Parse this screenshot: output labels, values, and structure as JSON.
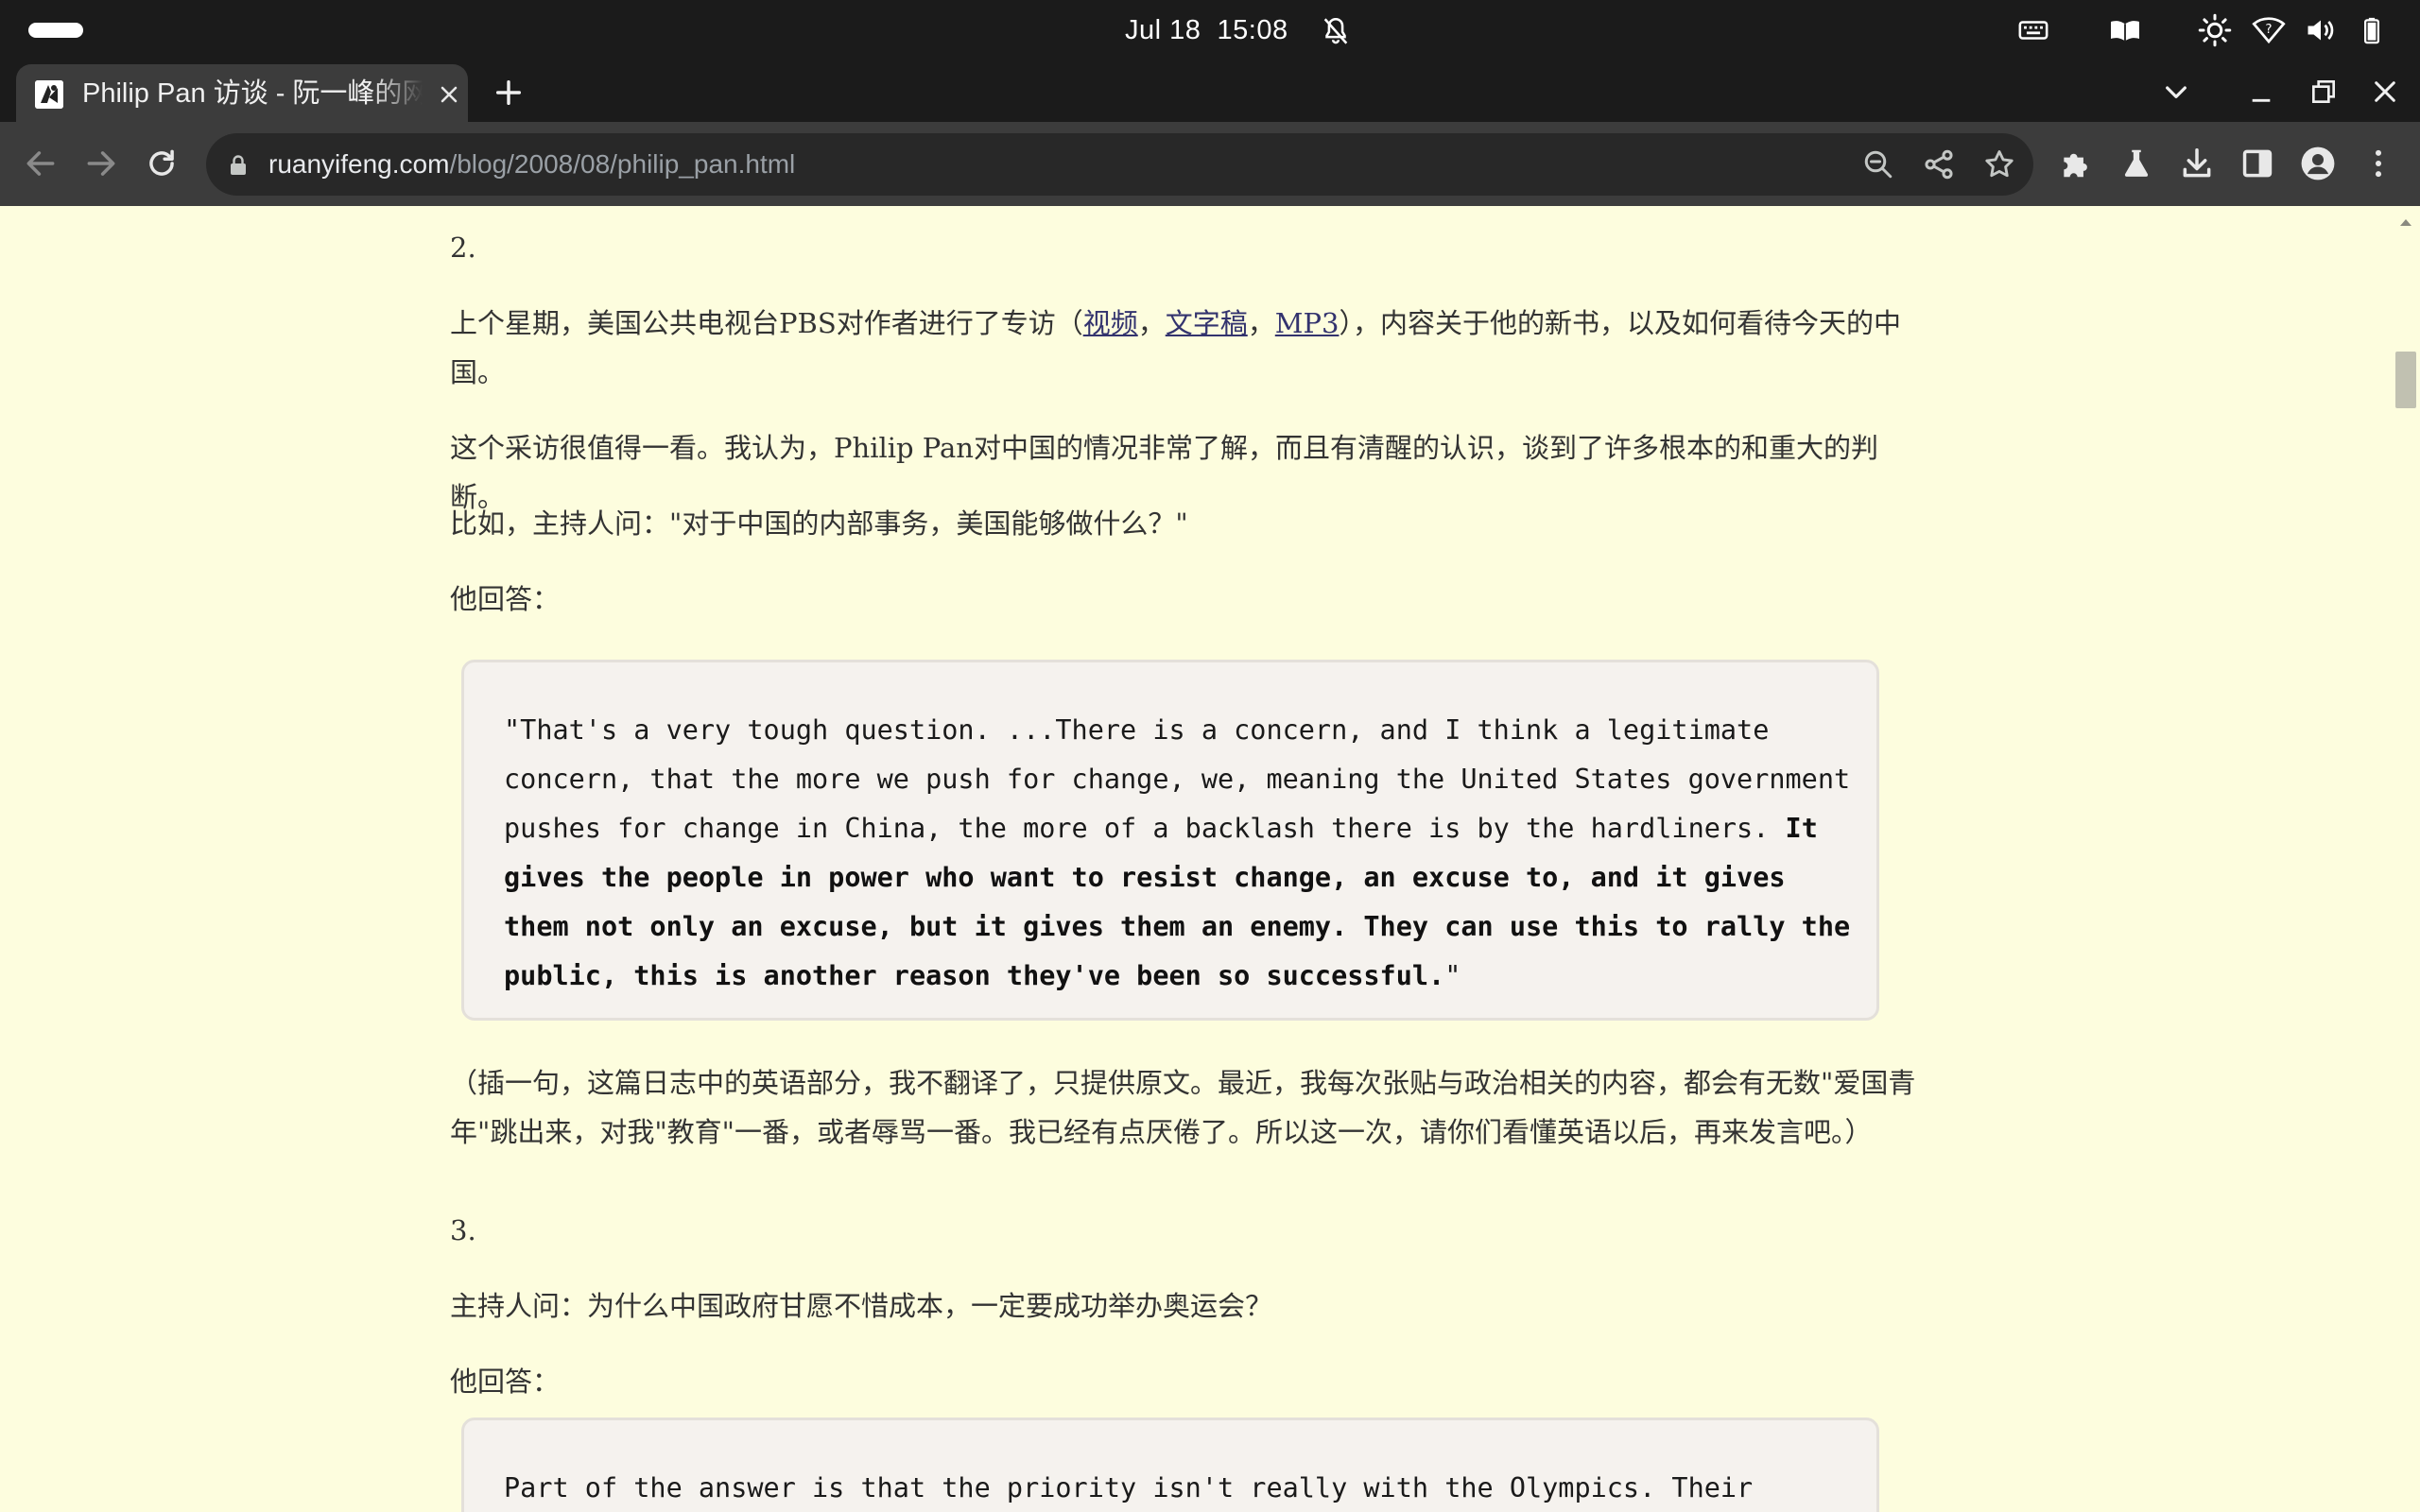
{
  "system": {
    "date": "Jul 18",
    "time": "15:08",
    "icons": [
      "activities-pill",
      "bell-muted-icon",
      "keyboard-icon",
      "reader-icon",
      "brightness-icon",
      "wifi-icon",
      "volume-icon",
      "battery-icon"
    ]
  },
  "browser": {
    "tab": {
      "title": "Philip Pan 访谈 - 阮一峰的网络日志"
    },
    "url": {
      "host": "ruanyifeng.com",
      "path": "/blog/2008/08/philip_pan.html"
    },
    "colors": {
      "chrome_dark": "#1b1b1b",
      "toolbar": "#3c3c3c",
      "omnibox": "#282828",
      "page_bg": "#fdfdde"
    }
  },
  "article": {
    "section2_label": "2.",
    "p1_before": "上个星期，美国公共电视台PBS对作者进行了专访（",
    "p1_link1": "视频",
    "p1_sep1": "，",
    "p1_link2": "文字稿",
    "p1_sep2": "，",
    "p1_link3": "MP3",
    "p1_after": "），内容关于他的新书，以及如何看待今天的中国。",
    "p2": "这个采访很值得一看。我认为，Philip Pan对中国的情况非常了解，而且有清醒的认识，谈到了许多根本的和重大的判断。",
    "p3": "比如，主持人问：\"对于中国的内部事务，美国能够做什么？\"",
    "p4": "他回答：",
    "quote1_plain": "\"That's a very tough question. ...There is a concern, and I think a legitimate concern, that the more we push for change, we, meaning the United States government pushes for change in China, the more of a backlash there is by the hardliners. ",
    "quote1_bold": "It gives the people in power who want to resist change, an excuse to, and it gives them not only an excuse, but it gives them an enemy. They can use this to rally the public, this is another reason they've been so successful.",
    "quote1_end": "\"",
    "p5": "（插一句，这篇日志中的英语部分，我不翻译了，只提供原文。最近，我每次张贴与政治相关的内容，都会有无数\"爱国青年\"跳出来，对我\"教育\"一番，或者辱骂一番。我已经有点厌倦了。所以这一次，请你们看懂英语以后，再来发言吧。）",
    "section3_label": "3.",
    "p6": "主持人问：为什么中国政府甘愿不惜成本，一定要成功举办奥运会？",
    "p7": "他回答：",
    "quote2_plain": "Part of the answer is that the priority isn't really with the Olympics. Their"
  }
}
